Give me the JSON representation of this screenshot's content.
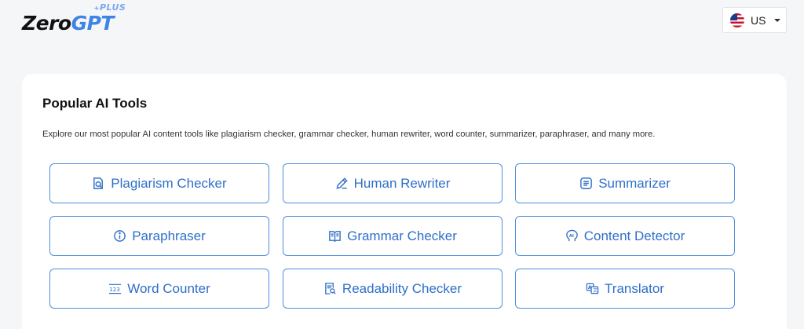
{
  "header": {
    "logo": {
      "part1": "Zero",
      "part2": "GPT",
      "badge": "PLUS"
    },
    "language": {
      "code": "US",
      "flag_icon": "us-flag-icon"
    }
  },
  "tools_section": {
    "title": "Popular AI Tools",
    "description": "Explore our most popular AI content tools like plagiarism checker, grammar checker, human rewriter, word counter, summarizer, paraphraser, and many more.",
    "tools": [
      {
        "label": "Plagiarism Checker",
        "icon": "plagiarism-icon"
      },
      {
        "label": "Human Rewriter",
        "icon": "pencil-icon"
      },
      {
        "label": "Summarizer",
        "icon": "summary-icon"
      },
      {
        "label": "Paraphraser",
        "icon": "info-icon"
      },
      {
        "label": "Grammar Checker",
        "icon": "book-icon"
      },
      {
        "label": "Content Detector",
        "icon": "ai-head-icon"
      },
      {
        "label": "Word Counter",
        "icon": "counter-123-icon"
      },
      {
        "label": "Readability Checker",
        "icon": "document-search-icon"
      },
      {
        "label": "Translator",
        "icon": "translate-icon"
      }
    ]
  },
  "colors": {
    "accent": "#2f6fc7",
    "border": "#4f8edc",
    "logo_blue": "#3f83e6"
  }
}
